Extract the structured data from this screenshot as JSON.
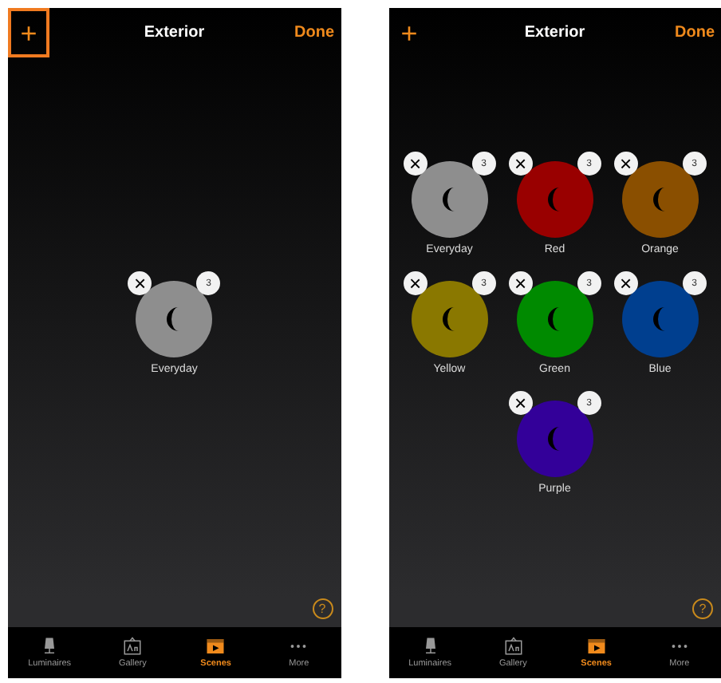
{
  "screens": [
    {
      "add_button": {
        "label": "+",
        "highlighted": true
      },
      "title": "Exterior",
      "done": "Done",
      "scenes": [
        {
          "name": "Everyday",
          "color": "#8e8e8e",
          "remove": "×",
          "count": "3"
        }
      ],
      "help": "?",
      "tabs": [
        {
          "label": "Luminaires",
          "selected": false
        },
        {
          "label": "Gallery",
          "selected": false
        },
        {
          "label": "Scenes",
          "selected": true
        },
        {
          "label": "More",
          "selected": false
        }
      ]
    },
    {
      "add_button": {
        "label": "+",
        "highlighted": false
      },
      "title": "Exterior",
      "done": "Done",
      "scenes": [
        {
          "name": "Everyday",
          "color": "#8e8e8e",
          "remove": "×",
          "count": "3"
        },
        {
          "name": "Red",
          "color": "#990000",
          "remove": "×",
          "count": "3"
        },
        {
          "name": "Orange",
          "color": "#8a4f00",
          "remove": "×",
          "count": "3"
        },
        {
          "name": "Yellow",
          "color": "#8a7800",
          "remove": "×",
          "count": "3"
        },
        {
          "name": "Green",
          "color": "#008a00",
          "remove": "×",
          "count": "3"
        },
        {
          "name": "Blue",
          "color": "#003f8f",
          "remove": "×",
          "count": "3"
        },
        {
          "name": "Purple",
          "color": "#330099",
          "remove": "×",
          "count": "3"
        }
      ],
      "help": "?",
      "tabs": [
        {
          "label": "Luminaires",
          "selected": false
        },
        {
          "label": "Gallery",
          "selected": false
        },
        {
          "label": "Scenes",
          "selected": true
        },
        {
          "label": "More",
          "selected": false
        }
      ]
    }
  ]
}
